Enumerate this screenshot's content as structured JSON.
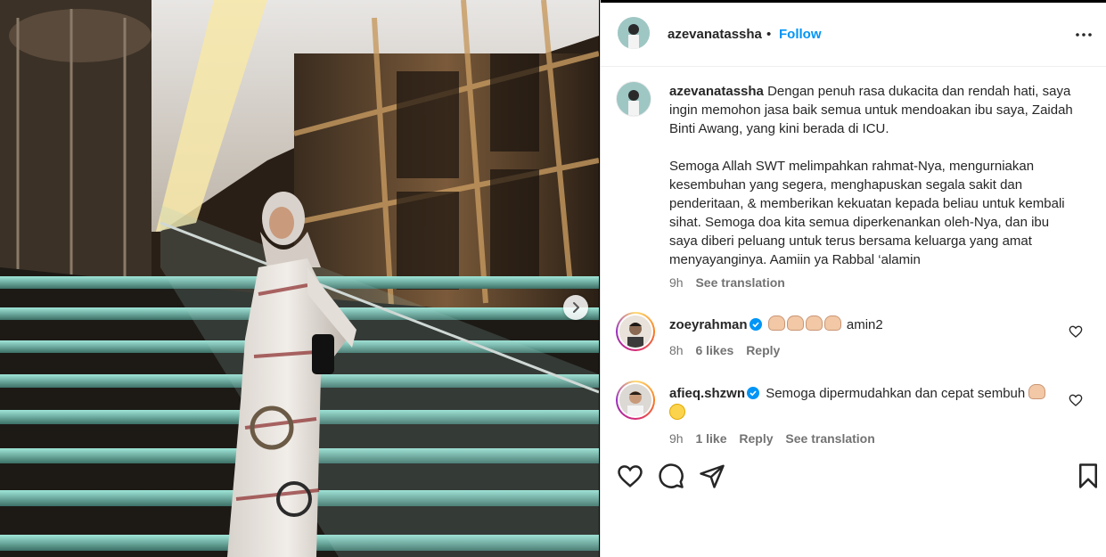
{
  "post": {
    "username": "azevanatassha",
    "separator": "•",
    "follow_label": "Follow",
    "more_icon": "more-dots-icon",
    "next_icon": "chevron-right-icon"
  },
  "caption": {
    "username": "azevanatassha",
    "paragraph1": "Dengan penuh rasa dukacita dan rendah hati, saya ingin memohon jasa baik semua untuk mendoakan ibu saya, Zaidah Binti Awang, yang kini berada di ICU.",
    "paragraph2": "Semoga Allah SWT melimpahkan rahmat-Nya, mengurniakan kesembuhan yang segera, menghapuskan segala sakit dan penderitaan, & memberikan kekuatan kepada beliau untuk kembali sihat. Semoga doa kita semua diperkenankan oleh-Nya, dan ibu saya diberi peluang untuk terus bersama keluarga yang amat menyayanginya. Aamiin ya Rabbal ‘alamin",
    "time": "9h",
    "see_translation": "See translation"
  },
  "comments": [
    {
      "username": "zoeyrahman",
      "text": "amin2",
      "time": "8h",
      "likes": "6 likes",
      "reply": "Reply"
    },
    {
      "username": "afieq.shzwn",
      "text": "Semoga dipermudahkan dan cepat sembuh",
      "time": "9h",
      "likes": "1 like",
      "reply": "Reply",
      "see_translation": "See translation"
    }
  ],
  "actions": {
    "like_icon": "heart-icon",
    "comment_icon": "comment-icon",
    "share_icon": "send-icon",
    "save_icon": "bookmark-icon"
  },
  "colors": {
    "follow": "#0095f6",
    "verified": "#0095f6",
    "meta": "#737373"
  }
}
